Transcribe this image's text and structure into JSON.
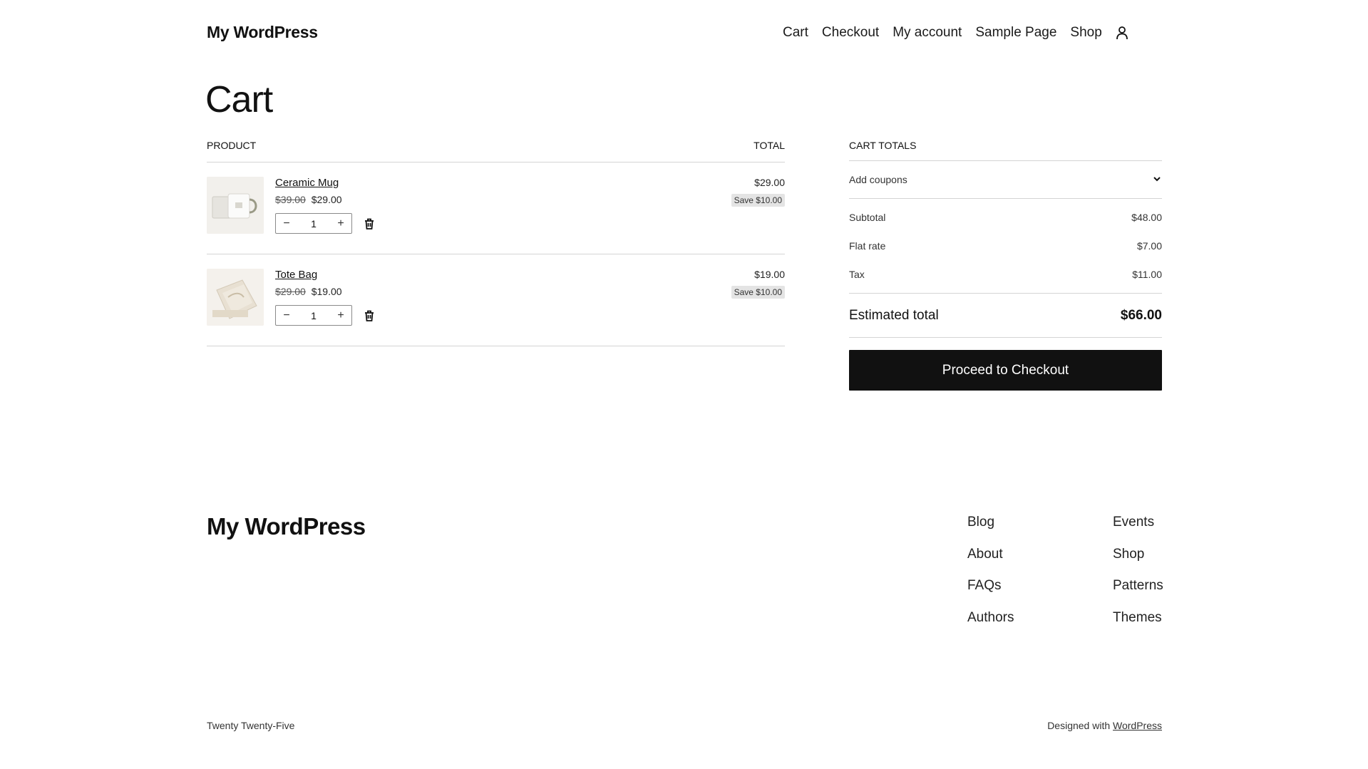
{
  "header": {
    "site_title": "My WordPress",
    "nav": [
      "Cart",
      "Checkout",
      "My account",
      "Sample Page",
      "Shop"
    ]
  },
  "page": {
    "title": "Cart"
  },
  "cart": {
    "columns": {
      "product": "PRODUCT",
      "total": "TOTAL"
    },
    "items": [
      {
        "name": "Ceramic Mug",
        "old_price": "$39.00",
        "price": "$29.00",
        "qty": "1",
        "line_total": "$29.00",
        "save": "Save $10.00"
      },
      {
        "name": "Tote Bag",
        "old_price": "$29.00",
        "price": "$19.00",
        "qty": "1",
        "line_total": "$19.00",
        "save": "Save $10.00"
      }
    ],
    "qty_minus": "−",
    "qty_plus": "+"
  },
  "totals": {
    "title": "CART TOTALS",
    "coupon_label": "Add coupons",
    "lines": [
      {
        "label": "Subtotal",
        "value": "$48.00"
      },
      {
        "label": "Flat rate",
        "value": "$7.00"
      },
      {
        "label": "Tax",
        "value": "$11.00"
      }
    ],
    "estimated_label": "Estimated total",
    "estimated_value": "$66.00",
    "checkout_label": "Proceed to Checkout"
  },
  "footer": {
    "title": "My WordPress",
    "col1": [
      "Blog",
      "About",
      "FAQs",
      "Authors"
    ],
    "col2": [
      "Events",
      "Shop",
      "Patterns",
      "Themes"
    ],
    "theme_name": "Twenty Twenty-Five",
    "designed_with": "Designed with",
    "wp_link": "WordPress"
  },
  "icons": {
    "account": "user-icon",
    "trash": "trash-icon",
    "coupon_toggle": "chevron-down-icon"
  }
}
